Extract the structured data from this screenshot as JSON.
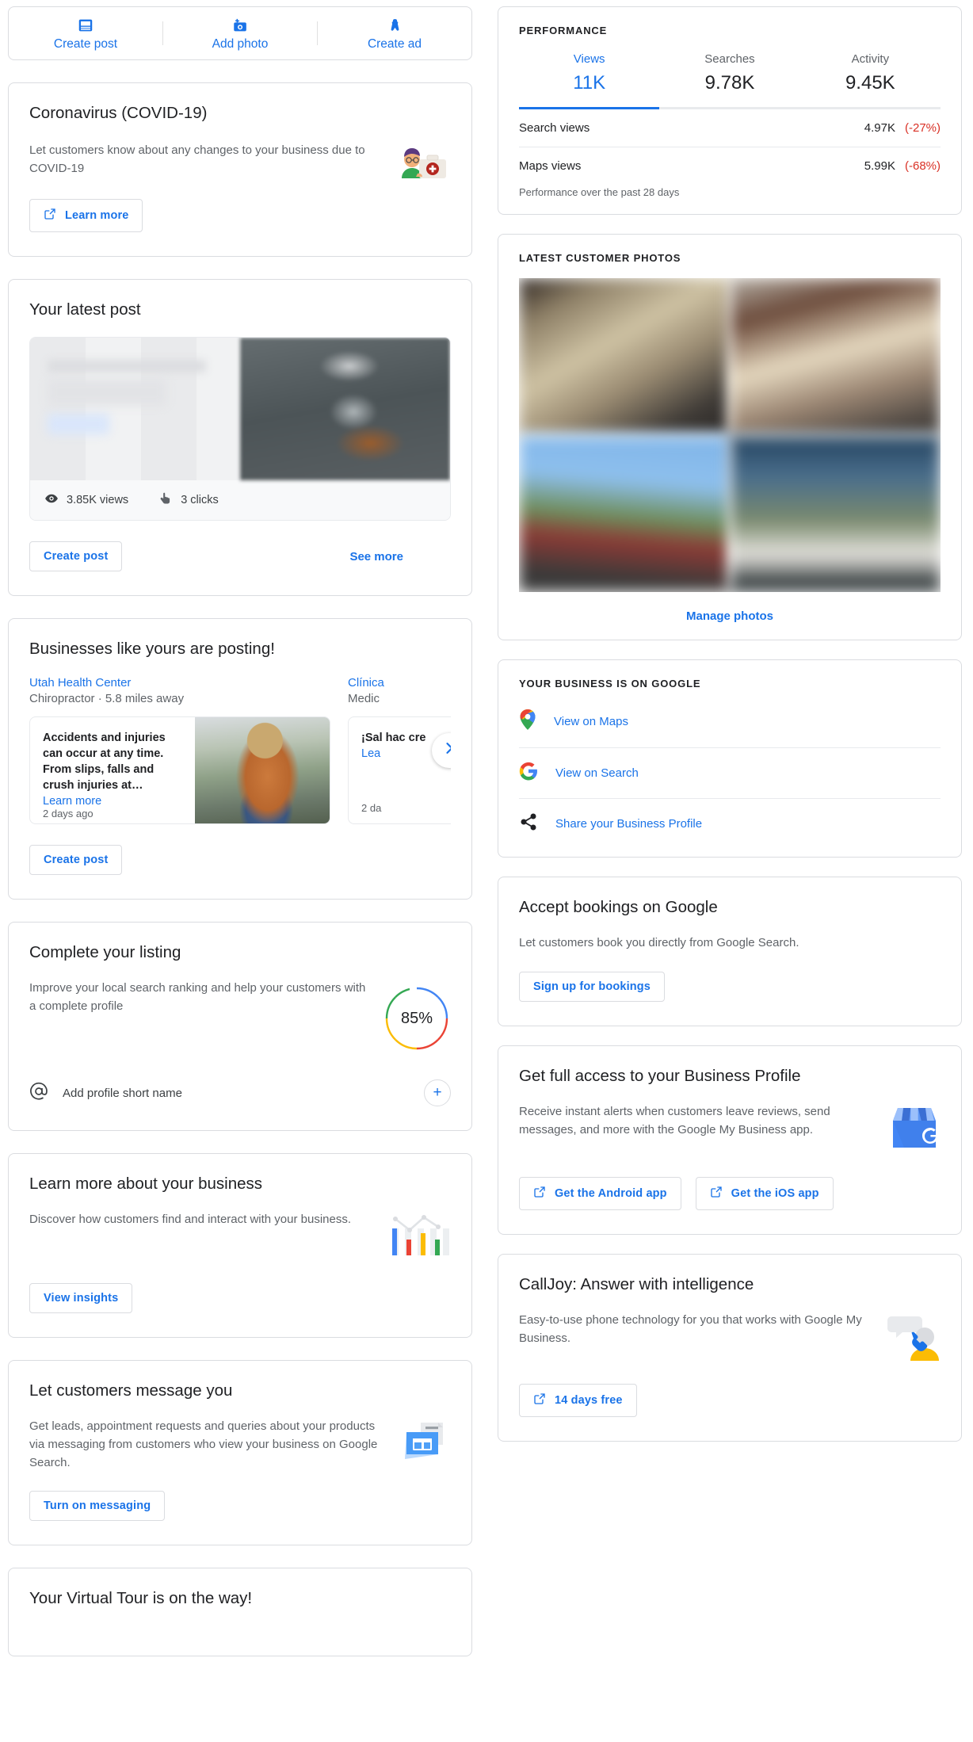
{
  "action_bar": {
    "items": [
      {
        "label": "Create post",
        "icon": "create-post-icon"
      },
      {
        "label": "Add photo",
        "icon": "add-photo-icon"
      },
      {
        "label": "Create ad",
        "icon": "google-ads-icon"
      }
    ]
  },
  "covid": {
    "title": "Coronavirus (COVID-19)",
    "body": "Let customers know about any changes to your business due to COVID-19",
    "button": "Learn more",
    "icon": "external-link-icon",
    "art": "doctor-first-aid-kit-illustration"
  },
  "latest_post": {
    "title": "Your latest post",
    "views": "3.85K views",
    "clicks": "3 clicks",
    "views_icon": "eye-icon",
    "clicks_icon": "tap-click-icon",
    "create_post": "Create post",
    "see_more": "See more"
  },
  "similar_businesses": {
    "title": "Businesses like yours are posting!",
    "create_post": "Create post",
    "next_icon": "chevron-right-icon",
    "items": [
      {
        "name": "Utah Health Center",
        "meta": "Chiropractor · 5.8 miles away",
        "snippet": "Accidents and injuries can occur at any time. From slips, falls and crush injuries at…",
        "learn_more": "Learn more",
        "age": "2 days ago"
      },
      {
        "name": "Clínica",
        "meta": "Medic",
        "snippet": "¡Sal hac cre",
        "learn_more": "Lea",
        "age": "2 da"
      }
    ]
  },
  "complete_listing": {
    "title": "Complete your listing",
    "body": "Improve your local search ranking and help your customers with a complete profile",
    "percent": "85%",
    "percent_value": 85,
    "task_label": "Add profile short name",
    "task_icon": "at-sign-icon",
    "add_icon": "plus-icon",
    "ring_colors": [
      "#4285f4",
      "#ea4335",
      "#fbbc04",
      "#34a853"
    ]
  },
  "learn_more_business": {
    "title": "Learn more about your business",
    "body": "Discover how customers find and interact with your business.",
    "button": "View insights",
    "art": "insights-bar-chart-illustration"
  },
  "messaging": {
    "title": "Let customers message you",
    "body": "Get leads, appointment requests and queries about your products via messaging from customers who view your business on Google Search.",
    "button": "Turn on messaging",
    "art": "storefront-message-illustration"
  },
  "virtual_tour": {
    "title": "Your Virtual Tour is on the way!"
  },
  "performance": {
    "eyebrow": "PERFORMANCE",
    "tabs": [
      {
        "label": "Views",
        "value": "11K",
        "active": true
      },
      {
        "label": "Searches",
        "value": "9.78K",
        "active": false
      },
      {
        "label": "Activity",
        "value": "9.45K",
        "active": false
      }
    ],
    "rows": [
      {
        "label": "Search views",
        "value": "4.97K",
        "delta": "(-27%)"
      },
      {
        "label": "Maps views",
        "value": "5.99K",
        "delta": "(-68%)"
      }
    ],
    "note": "Performance over the past 28 days",
    "delta_color": "#d93025",
    "accent_color": "#1a73e8"
  },
  "customer_photos": {
    "eyebrow": "LATEST CUSTOMER PHOTOS",
    "manage": "Manage photos",
    "count": 4
  },
  "on_google": {
    "eyebrow": "YOUR BUSINESS IS ON GOOGLE",
    "items": [
      {
        "label": "View on Maps",
        "icon": "google-maps-pin-icon"
      },
      {
        "label": "View on Search",
        "icon": "google-g-icon"
      },
      {
        "label": "Share your Business Profile",
        "icon": "share-icon"
      }
    ]
  },
  "bookings": {
    "title": "Accept bookings on Google",
    "body": "Let customers book you directly from Google Search.",
    "button": "Sign up for bookings"
  },
  "full_access": {
    "title": "Get full access to your Business Profile",
    "body": "Receive instant alerts when customers leave reviews, send messages, and more with the Google My Business app.",
    "android_button": "Get the Android app",
    "ios_button": "Get the iOS app",
    "art": "google-my-business-storefront-icon"
  },
  "calljoy": {
    "title": "CallJoy: Answer with intelligence",
    "body": "Easy-to-use phone technology for you that works with Google My Business.",
    "button": "14 days free",
    "art": "calljoy-phone-person-illustration"
  }
}
